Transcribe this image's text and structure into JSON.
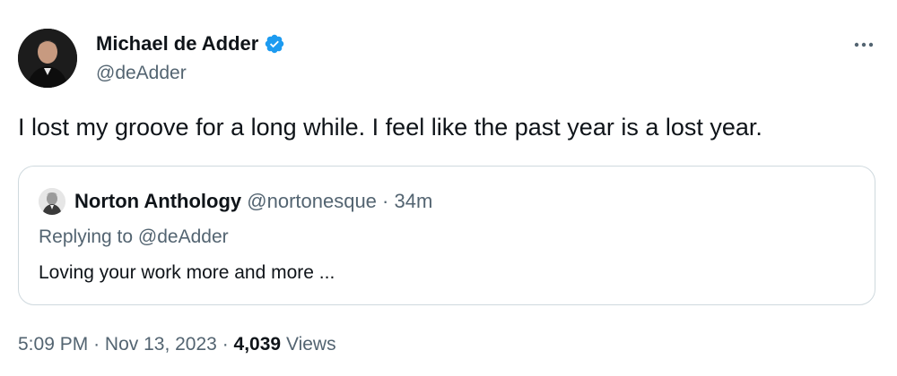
{
  "author": {
    "name": "Michael de Adder",
    "handle": "@deAdder",
    "verified": true
  },
  "tweet": {
    "text": "I lost my groove for a long while. I feel like the past year is a lost year."
  },
  "quoted": {
    "name": "Norton Anthology",
    "handle": "@nortonesque",
    "separator": "·",
    "time": "34m",
    "replying_to": "Replying to @deAdder",
    "text": "Loving your work more and more ..."
  },
  "meta": {
    "time": "5:09 PM",
    "date": "Nov 13, 2023",
    "separator": "·",
    "views_count": "4,039",
    "views_label": "Views"
  },
  "icons": {
    "verified": "verified-badge-icon",
    "more": "more-options-icon"
  },
  "colors": {
    "text_primary": "#0f1419",
    "text_secondary": "#536471",
    "verified_blue": "#1d9bf0",
    "border": "#cfd9de"
  }
}
